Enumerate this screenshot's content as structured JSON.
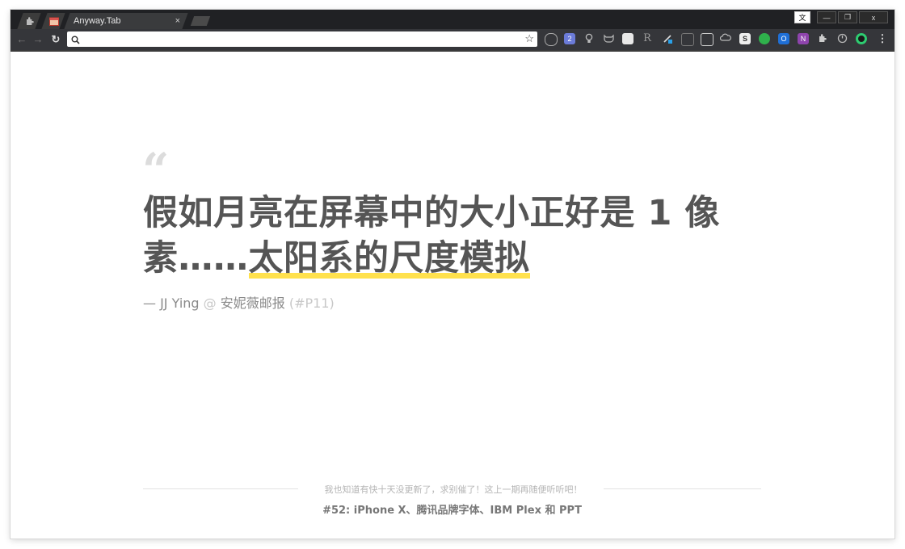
{
  "browser": {
    "active_tab_title": "Anyway.Tab",
    "tab_close_glyph": "×",
    "window_controls": {
      "lang": "文",
      "minimize": "—",
      "restore": "❐",
      "close": "x"
    },
    "nav": {
      "back": "←",
      "forward": "→",
      "reload": "↻"
    },
    "omnibox": {
      "value": "",
      "placeholder": ""
    },
    "bookmark_glyph": "☆",
    "menu_glyph": "⋮",
    "extension_icons": [
      "evernote-icon",
      "v2-badge-icon",
      "bulb-icon",
      "cat-icon",
      "notes-icon",
      "r-icon",
      "eyedropper-icon",
      "screen-icon",
      "goggles-icon",
      "cloud-icon",
      "s-icon",
      "chat-icon",
      "outlook-icon",
      "onenote-icon",
      "puzzle-icon",
      "timer-icon",
      "color-icon"
    ],
    "extension_labels": {
      "r": "R",
      "s": "S",
      "onenote": "N",
      "outlook": "O",
      "v2": "2"
    }
  },
  "page": {
    "quote_mark": "“",
    "headline_part1": "假如月亮在屏幕中的大小正好是 1 像素……",
    "headline_highlight": "太阳系的尺度模拟",
    "author": "— JJ Ying",
    "at": " @ ",
    "source": "安妮薇邮报",
    "issue": " (#P11)",
    "footer_note": "我也知道有快十天没更新了，求别催了！这上一期再随便听听吧！",
    "footer_link": "#52: iPhone X、腾讯品牌字体、IBM Plex 和 PPT"
  },
  "colors": {
    "highlight": "#ffe14d",
    "headline": "#555555",
    "chrome_dark": "#202124",
    "toolbar": "#35363a"
  }
}
